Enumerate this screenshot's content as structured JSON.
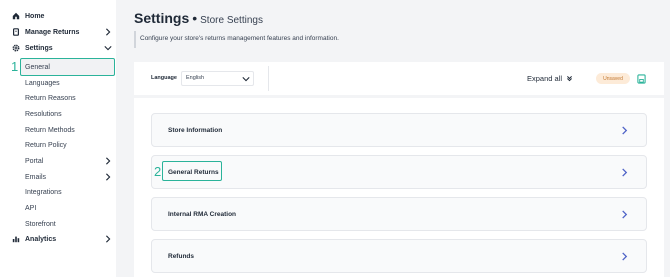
{
  "sidebar": {
    "items": [
      {
        "label": "Home",
        "icon": "home-icon"
      },
      {
        "label": "Manage Returns",
        "icon": "returns-icon"
      },
      {
        "label": "Settings",
        "icon": "gear-icon"
      },
      {
        "label": "General"
      },
      {
        "label": "Languages"
      },
      {
        "label": "Return Reasons"
      },
      {
        "label": "Resolutions"
      },
      {
        "label": "Return Methods"
      },
      {
        "label": "Return Policy"
      },
      {
        "label": "Portal"
      },
      {
        "label": "Emails"
      },
      {
        "label": "Integrations"
      },
      {
        "label": "API"
      },
      {
        "label": "Storefront"
      },
      {
        "label": "Analytics",
        "icon": "bar-chart-icon"
      }
    ]
  },
  "annotations": {
    "step1": "1",
    "step2": "2",
    "accent_color": "#2bb39a"
  },
  "header": {
    "title": "Settings",
    "separator": "•",
    "subtitle": "Store Settings",
    "description": "Configure your store's returns management features and information."
  },
  "toolbar": {
    "language_label": "Language",
    "language_value": "English",
    "expand_label": "Expand all",
    "status_badge": "Unsaved"
  },
  "sections": [
    {
      "label": "Store Information"
    },
    {
      "label": "General Returns"
    },
    {
      "label": "Internal RMA Creation"
    },
    {
      "label": "Refunds"
    }
  ]
}
